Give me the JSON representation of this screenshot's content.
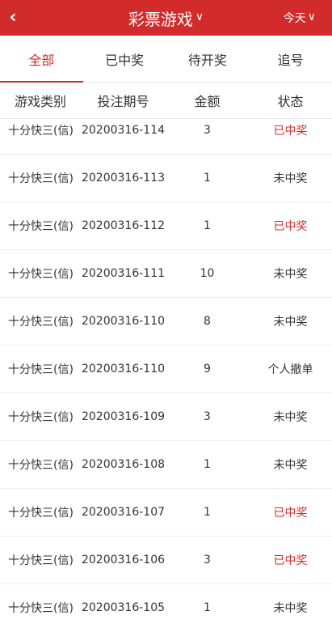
{
  "header": {
    "back_icon": "chevron-left-icon",
    "title": "彩票游戏",
    "range": "今天"
  },
  "tabs": [
    {
      "label": "全部",
      "active": true
    },
    {
      "label": "已中奖",
      "active": false
    },
    {
      "label": "待开奖",
      "active": false
    },
    {
      "label": "追号",
      "active": false
    }
  ],
  "table": {
    "headers": [
      "游戏类别",
      "投注期号",
      "金额",
      "状态"
    ],
    "rows": [
      {
        "game": "十分快三(信)",
        "period": "20200316-114",
        "amount": "3",
        "status": "已中奖",
        "won": true
      },
      {
        "game": "十分快三(信)",
        "period": "20200316-113",
        "amount": "1",
        "status": "未中奖",
        "won": false
      },
      {
        "game": "十分快三(信)",
        "period": "20200316-112",
        "amount": "1",
        "status": "已中奖",
        "won": true
      },
      {
        "game": "十分快三(信)",
        "period": "20200316-111",
        "amount": "10",
        "status": "未中奖",
        "won": false
      },
      {
        "game": "十分快三(信)",
        "period": "20200316-110",
        "amount": "8",
        "status": "未中奖",
        "won": false
      },
      {
        "game": "十分快三(信)",
        "period": "20200316-110",
        "amount": "9",
        "status": "个人撤单",
        "won": false
      },
      {
        "game": "十分快三(信)",
        "period": "20200316-109",
        "amount": "3",
        "status": "未中奖",
        "won": false
      },
      {
        "game": "十分快三(信)",
        "period": "20200316-108",
        "amount": "1",
        "status": "未中奖",
        "won": false
      },
      {
        "game": "十分快三(信)",
        "period": "20200316-107",
        "amount": "1",
        "status": "已中奖",
        "won": true
      },
      {
        "game": "十分快三(信)",
        "period": "20200316-106",
        "amount": "3",
        "status": "已中奖",
        "won": true
      },
      {
        "game": "十分快三(信)",
        "period": "20200316-105",
        "amount": "1",
        "status": "未中奖",
        "won": false
      }
    ]
  },
  "colors": {
    "accent": "#d22b2b"
  }
}
